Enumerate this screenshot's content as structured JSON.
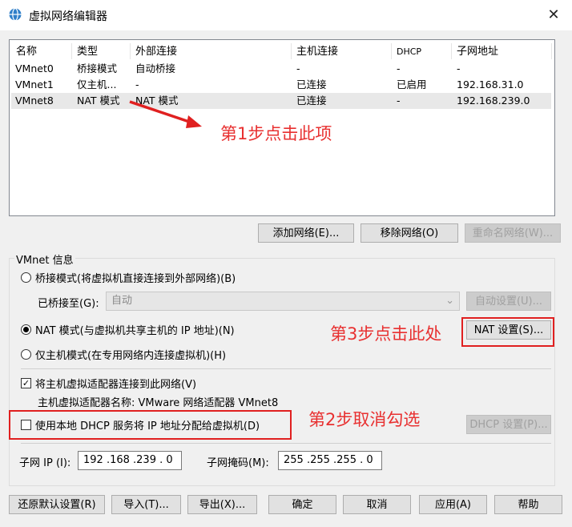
{
  "window": {
    "title": "虚拟网络编辑器",
    "close": "✕"
  },
  "table": {
    "headers": [
      "名称",
      "类型",
      "外部连接",
      "主机连接",
      "DHCP",
      "子网地址"
    ],
    "rows": [
      [
        "VMnet0",
        "桥接模式",
        "自动桥接",
        "-",
        "-",
        "-"
      ],
      [
        "VMnet1",
        "仅主机...",
        "-",
        "已连接",
        "已启用",
        "192.168.31.0"
      ],
      [
        "VMnet8",
        "NAT 模式",
        "NAT 模式",
        "已连接",
        "-",
        "192.168.239.0"
      ]
    ],
    "selected_row": 2
  },
  "table_buttons": {
    "add": "添加网络(E)...",
    "remove": "移除网络(O)",
    "rename": "重命名网络(W)..."
  },
  "info": {
    "group_label": "VMnet 信息",
    "bridge_radio": "桥接模式(将虚拟机直接连接到外部网络)(B)",
    "bridged_to_label": "已桥接至(G):",
    "bridged_to_value": "自动",
    "auto_settings": "自动设置(U)...",
    "nat_radio": "NAT 模式(与虚拟机共享主机的 IP 地址)(N)",
    "nat_settings": "NAT 设置(S)...",
    "host_only_radio": "仅主机模式(在专用网络内连接虚拟机)(H)",
    "connect_adapter": "将主机虚拟适配器连接到此网络(V)",
    "adapter_name": "主机虚拟适配器名称: VMware 网络适配器 VMnet8",
    "use_dhcp": "使用本地 DHCP 服务将 IP 地址分配给虚拟机(D)",
    "dhcp_settings": "DHCP 设置(P)...",
    "subnet_ip_label": "子网 IP (I):",
    "subnet_ip_value": "192 .168 .239 .  0",
    "subnet_mask_label": "子网掩码(M):",
    "subnet_mask_value": "255 .255 .255 .  0",
    "selected_mode": "nat",
    "connect_adapter_checked": true,
    "use_dhcp_checked": false
  },
  "footer": {
    "restore": "还原默认设置(R)",
    "import": "导入(T)...",
    "export": "导出(X)...",
    "ok": "确定",
    "cancel": "取消",
    "apply": "应用(A)",
    "help": "帮助"
  },
  "annotations": {
    "step1": "第1步点击此项",
    "step2": "第2步取消勾选",
    "step3": "第3步点击此处"
  },
  "colors": {
    "annotation": "#e83030",
    "selection": "#e8e8e8"
  }
}
